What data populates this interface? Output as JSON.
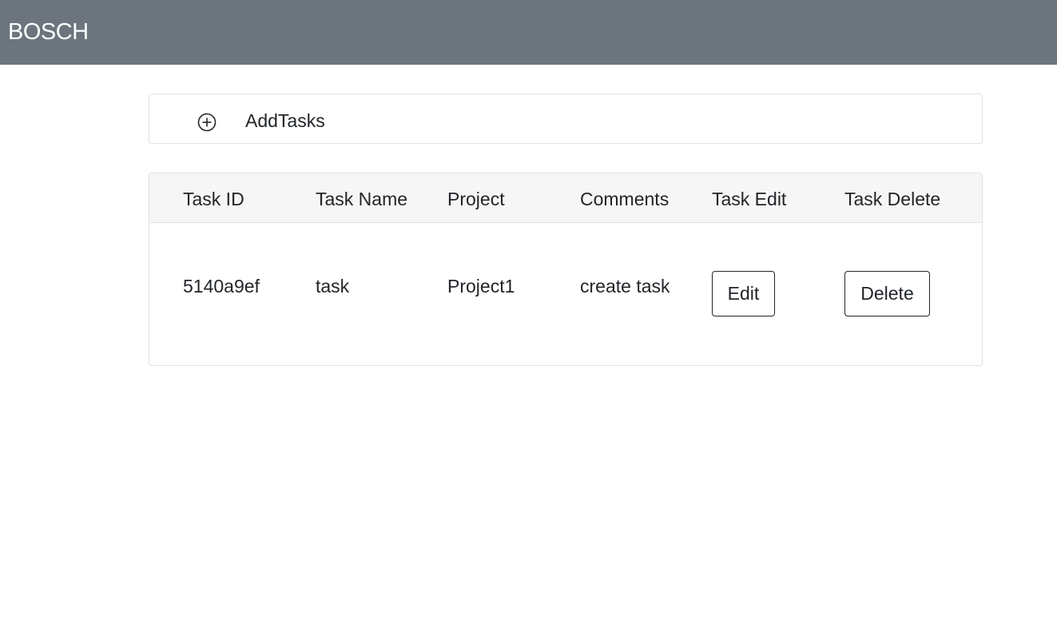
{
  "navbar": {
    "brand": "BOSCH"
  },
  "add_tasks": {
    "icon": "plus-circle-icon",
    "label": "AddTasks"
  },
  "table": {
    "headers": [
      "Task ID",
      "Task Name",
      "Project",
      "Comments",
      "Task Edit",
      "Task Delete"
    ],
    "rows": [
      {
        "task_id": "5140a9ef",
        "task_name": "task",
        "project": "Project1",
        "comments": "create task",
        "edit_label": "Edit",
        "delete_label": "Delete"
      }
    ]
  },
  "colors": {
    "navbar_bg": "#6c757d",
    "table_header_bg": "#f6f6f6",
    "border": "#dfe1e3",
    "text": "#212529"
  }
}
